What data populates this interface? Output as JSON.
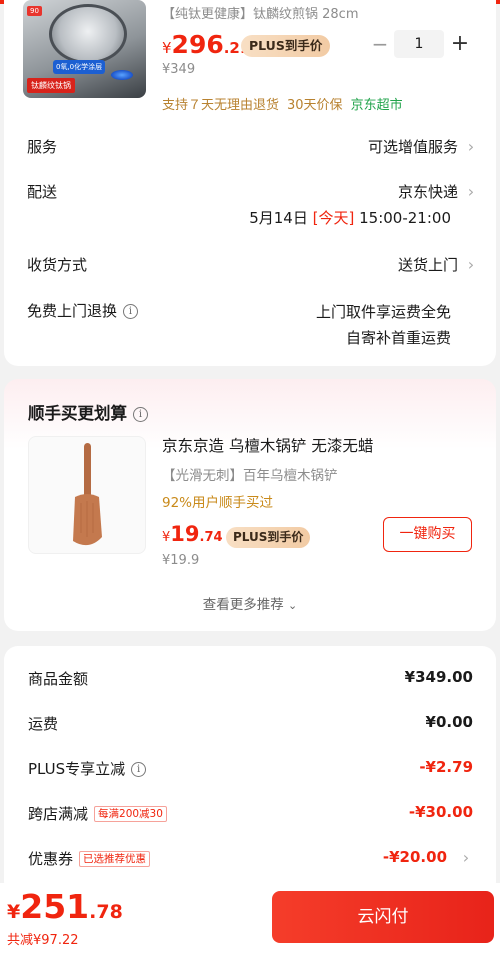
{
  "product": {
    "title": "【纯钛更健康】钛麟纹煎锅 28cm",
    "price_currency": "¥",
    "price_int": "296",
    "price_dec": ".21",
    "plus_badge": "PLUS到手价",
    "orig_price": "¥349",
    "quantity": "1",
    "minus": "−",
    "plus": "+",
    "image_tags": [
      "90",
      "钛麟纹钛锅",
      "0氧,0化学涂层"
    ],
    "service_tags": [
      "支持７天无理由退货",
      "30天价保"
    ],
    "store_tag": "京东超市"
  },
  "order_rows": {
    "service_label": "服务",
    "service_value": "可选增值服务",
    "delivery_label": "配送",
    "delivery_value": "京东快递",
    "delivery_date": "5月14日",
    "delivery_today": "[今天]",
    "delivery_window": "15:00-21:00",
    "receive_label": "收货方式",
    "receive_value": "送货上门",
    "free_return_label": "免费上门退换",
    "free_return_line1": "上门取件享运费全免",
    "free_return_line2": "自寄补首重运费"
  },
  "addon": {
    "section_title": "顺手买更划算",
    "title": "京东京造 乌檀木锅铲 无漆无蜡",
    "subtitle": "【光滑无刺】百年乌檀木锅铲",
    "buyers": "92%用户顺手买过",
    "price_currency": "¥",
    "price_int": "19",
    "price_dec": ".74",
    "plus_badge": "PLUS到手价",
    "orig_price": "¥19.9",
    "buy_button": "一键购买",
    "more": "查看更多推荐"
  },
  "summary": {
    "goods_label": "商品金额",
    "goods_value": "¥349.00",
    "shipping_label": "运费",
    "shipping_value": "¥0.00",
    "plus_label": "PLUS专享立减",
    "plus_value": "-¥2.79",
    "cross_label": "跨店满减",
    "cross_tag": "每满200减30",
    "cross_value": "-¥30.00",
    "coupon_label": "优惠券",
    "coupon_tag": "已选推荐优惠",
    "coupon_value": "-¥20.00"
  },
  "footer": {
    "total_currency": "¥",
    "total_int": "251",
    "total_dec": ".78",
    "saved": "共减¥97.22",
    "pay_button": "云闪付"
  },
  "colors": {
    "accent": "#f0250f",
    "gold_text": "#b88230",
    "green": "#21a34b"
  }
}
